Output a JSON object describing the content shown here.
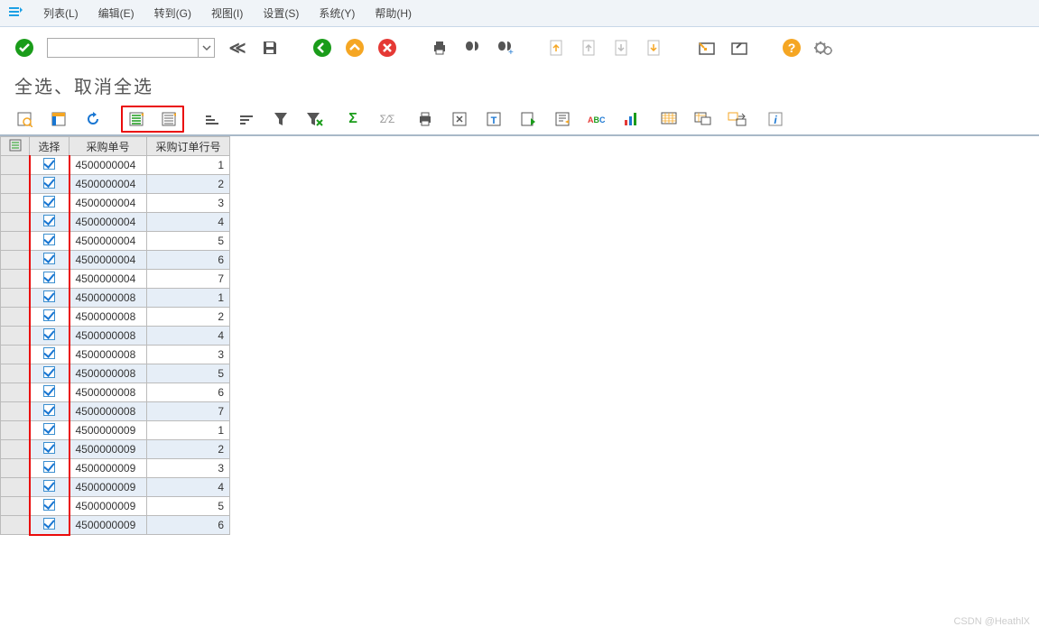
{
  "menubar": {
    "items": [
      {
        "label": "列表(L)"
      },
      {
        "label": "编辑(E)"
      },
      {
        "label": "转到(G)"
      },
      {
        "label": "视图(I)"
      },
      {
        "label": "设置(S)"
      },
      {
        "label": "系统(Y)"
      },
      {
        "label": "帮助(H)"
      }
    ]
  },
  "commandField": {
    "value": ""
  },
  "title": "全选、取消全选",
  "toolbar1": {
    "icons": [
      "enter",
      "back",
      "save",
      "exit",
      "up",
      "cancel",
      "print",
      "find",
      "find-next",
      "first",
      "prev",
      "next",
      "last",
      "create-session",
      "close-session",
      "help",
      "customize"
    ]
  },
  "toolbar2": {
    "group1": [
      "details",
      "layout",
      "refresh"
    ],
    "highlight": [
      "select-all",
      "deselect-all"
    ],
    "group2": [
      "sort-asc",
      "sort-desc",
      "filter",
      "clear-filter"
    ],
    "group3": [
      "sum",
      "subtotal"
    ],
    "group4": [
      "print2",
      "export-xls",
      "export-word",
      "export-local",
      "export-mail",
      "abc",
      "graphic"
    ],
    "group5": [
      "choose-layout",
      "change-layout",
      "save-layout"
    ],
    "group6": [
      "info"
    ]
  },
  "grid": {
    "headers": {
      "select": "选择",
      "po": "采购单号",
      "line": "采购订单行号"
    },
    "rows": [
      {
        "sel": true,
        "po": "4500000004",
        "line": "1",
        "alt": false
      },
      {
        "sel": true,
        "po": "4500000004",
        "line": "2",
        "alt": true
      },
      {
        "sel": true,
        "po": "4500000004",
        "line": "3",
        "alt": false
      },
      {
        "sel": true,
        "po": "4500000004",
        "line": "4",
        "alt": true
      },
      {
        "sel": true,
        "po": "4500000004",
        "line": "5",
        "alt": false
      },
      {
        "sel": true,
        "po": "4500000004",
        "line": "6",
        "alt": true
      },
      {
        "sel": true,
        "po": "4500000004",
        "line": "7",
        "alt": false
      },
      {
        "sel": true,
        "po": "4500000008",
        "line": "1",
        "alt": true
      },
      {
        "sel": true,
        "po": "4500000008",
        "line": "2",
        "alt": false
      },
      {
        "sel": true,
        "po": "4500000008",
        "line": "4",
        "alt": true
      },
      {
        "sel": true,
        "po": "4500000008",
        "line": "3",
        "alt": false
      },
      {
        "sel": true,
        "po": "4500000008",
        "line": "5",
        "alt": true
      },
      {
        "sel": true,
        "po": "4500000008",
        "line": "6",
        "alt": false
      },
      {
        "sel": true,
        "po": "4500000008",
        "line": "7",
        "alt": true
      },
      {
        "sel": true,
        "po": "4500000009",
        "line": "1",
        "alt": false
      },
      {
        "sel": true,
        "po": "4500000009",
        "line": "2",
        "alt": true
      },
      {
        "sel": true,
        "po": "4500000009",
        "line": "3",
        "alt": false
      },
      {
        "sel": true,
        "po": "4500000009",
        "line": "4",
        "alt": true
      },
      {
        "sel": true,
        "po": "4500000009",
        "line": "5",
        "alt": false
      },
      {
        "sel": true,
        "po": "4500000009",
        "line": "6",
        "alt": true
      }
    ]
  },
  "watermark": "CSDN @HeathlX"
}
